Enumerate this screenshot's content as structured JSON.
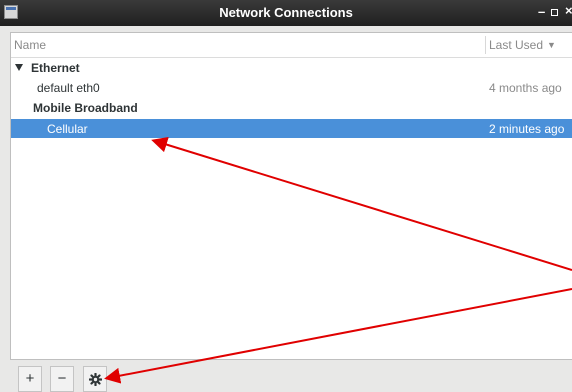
{
  "window": {
    "title": "Network Connections",
    "controls": {
      "minimize": "–",
      "close": "×"
    }
  },
  "list": {
    "columns": {
      "name": "Name",
      "last_used": "Last Used"
    },
    "groups": [
      {
        "label": "Ethernet",
        "expanded": true,
        "connections": [
          {
            "name": "default eth0",
            "last_used": "4 months ago",
            "selected": false
          }
        ]
      },
      {
        "label": "Mobile Broadband",
        "expanded": true,
        "connections": [
          {
            "name": "Cellular",
            "last_used": "2 minutes ago",
            "selected": true
          }
        ]
      }
    ]
  },
  "toolbar": {
    "add": "+",
    "remove": "−",
    "settings_icon": "gear-icon"
  },
  "colors": {
    "selection": "#4a90d9",
    "annotation_arrow": "#e00000",
    "titlebar": "#2b2b2b"
  }
}
